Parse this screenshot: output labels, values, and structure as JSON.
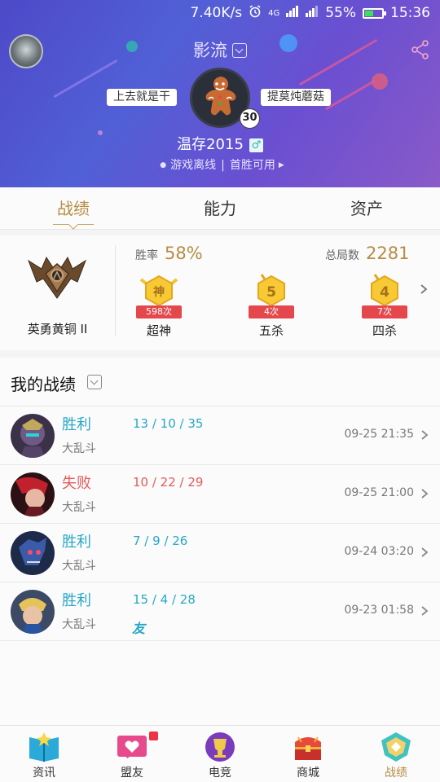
{
  "status_bar": {
    "speed": "7.40K/s",
    "alarm_icon": "alarm-icon",
    "network": "4G",
    "battery_percent": "55%",
    "battery_level": 0.55,
    "time": "15:36"
  },
  "header": {
    "server": "影流",
    "tag_left": "上去就是干",
    "tag_right": "提莫炖蘑菇",
    "level": "30",
    "username": "温存2015",
    "gender_symbol": "♂",
    "game_state": "游戏离线",
    "first_win": "首胜可用",
    "share_icon": "share-icon"
  },
  "tabs": [
    {
      "label": "战绩",
      "active": true
    },
    {
      "label": "能力",
      "active": false
    },
    {
      "label": "资产",
      "active": false
    }
  ],
  "rank": {
    "name": "英勇黄铜 II",
    "win_rate_label": "胜率",
    "win_rate": "58%",
    "total_label": "总局数",
    "total": "2281",
    "achievements": [
      {
        "glyph": "神",
        "count": "598次",
        "label": "超神"
      },
      {
        "glyph": "5",
        "count": "4次",
        "label": "五杀"
      },
      {
        "glyph": "4",
        "count": "7次",
        "label": "四杀"
      }
    ]
  },
  "records": {
    "title": "我的战绩",
    "items": [
      {
        "result": "胜利",
        "outcome": "win",
        "mode": "大乱斗",
        "kda": "13 / 10 / 35",
        "time": "09-25 21:35",
        "extra": ""
      },
      {
        "result": "失败",
        "outcome": "lose",
        "mode": "大乱斗",
        "kda": "10 / 22 / 29",
        "time": "09-25 21:00",
        "extra": ""
      },
      {
        "result": "胜利",
        "outcome": "win",
        "mode": "大乱斗",
        "kda": "7 / 9 / 26",
        "time": "09-24 03:20",
        "extra": ""
      },
      {
        "result": "胜利",
        "outcome": "win",
        "mode": "大乱斗",
        "kda": "15 / 4 / 28",
        "time": "09-23 01:58",
        "extra": "友"
      }
    ]
  },
  "bottom_nav": [
    {
      "label": "资讯",
      "icon": "book-icon",
      "active": false
    },
    {
      "label": "盟友",
      "icon": "heart-chat-icon",
      "active": false,
      "badge": true
    },
    {
      "label": "电竞",
      "icon": "trophy-icon",
      "active": false
    },
    {
      "label": "商城",
      "icon": "treasure-chest-icon",
      "active": false
    },
    {
      "label": "战绩",
      "icon": "crest-icon",
      "active": true
    }
  ],
  "colors": {
    "accent_gold": "#b58d44",
    "win": "#27a8c6",
    "lose": "#e65a5a",
    "header_start": "#4e49c8",
    "header_end": "#8a5ac8"
  }
}
